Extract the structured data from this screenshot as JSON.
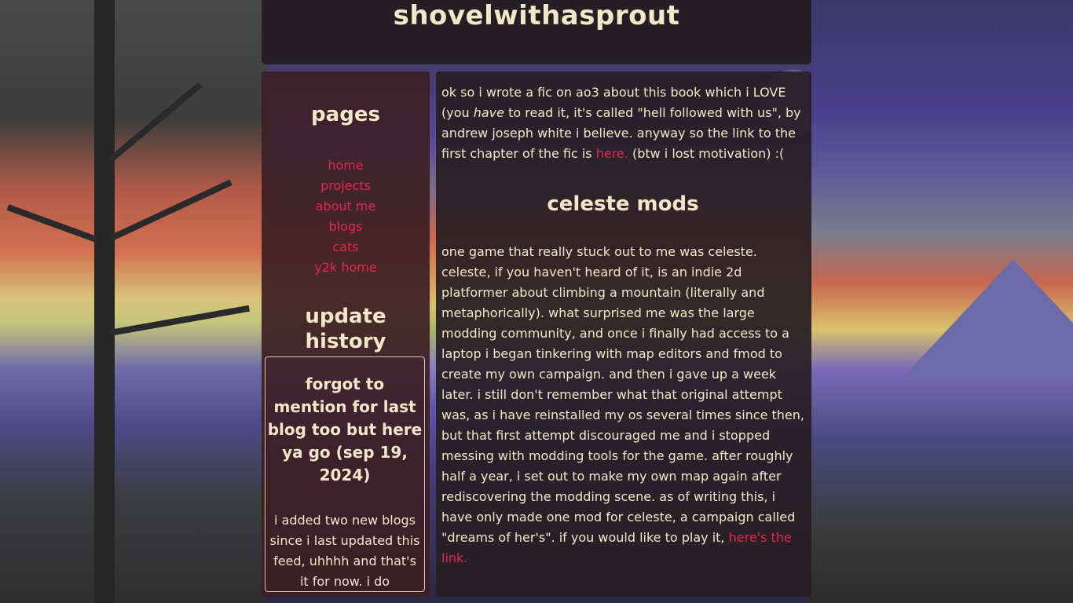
{
  "site": {
    "title": "shovelwithasprout"
  },
  "sidebar": {
    "pages_heading": "pages",
    "nav": [
      {
        "label": "home"
      },
      {
        "label": "projects"
      },
      {
        "label": "about me"
      },
      {
        "label": "blogs"
      },
      {
        "label": "cats"
      },
      {
        "label": "y2k home"
      }
    ],
    "update_heading": "update history",
    "update_entry": {
      "title": "forgot to mention for last blog too but here ya go (sep 19, 2024)",
      "body": "i added two new blogs since i last updated this feed, uhhhh and that's it for now. i do recommend you check"
    }
  },
  "main": {
    "intro": {
      "text_before_emphasis": "ok so i wrote a fic on ao3 about this book which i LOVE (you ",
      "emphasis": "have",
      "text_after_emphasis": " to read it, it's called \"hell followed with us\", by andrew joseph white i believe. anyway so the link to the first chapter of the fic is ",
      "link": "here.",
      "text_after_link": " (btw i lost motivation) :("
    },
    "mods_heading": "celeste mods",
    "mods": {
      "text": "one game that really stuck out to me was celeste. celeste, if you haven't heard of it, is an indie 2d platformer about climbing a mountain (literally and metaphorically). what surprised me was the large modding community, and once i finally had access to a laptop i began tinkering with map editors and fmod to create my own campaign. and then i gave up a week later. i still don't remember what that original attempt was, as i have reinstalled my os several times since then, but that first attempt discouraged me and i stopped messing with modding tools for the game. after roughly half a year, i set out to make my own map again after rediscovering the modding scene. as of writing this, i have only made one mod for celeste, a campaign called \"dreams of her's\". if you would like to play it, ",
      "link": "here's the link."
    }
  }
}
